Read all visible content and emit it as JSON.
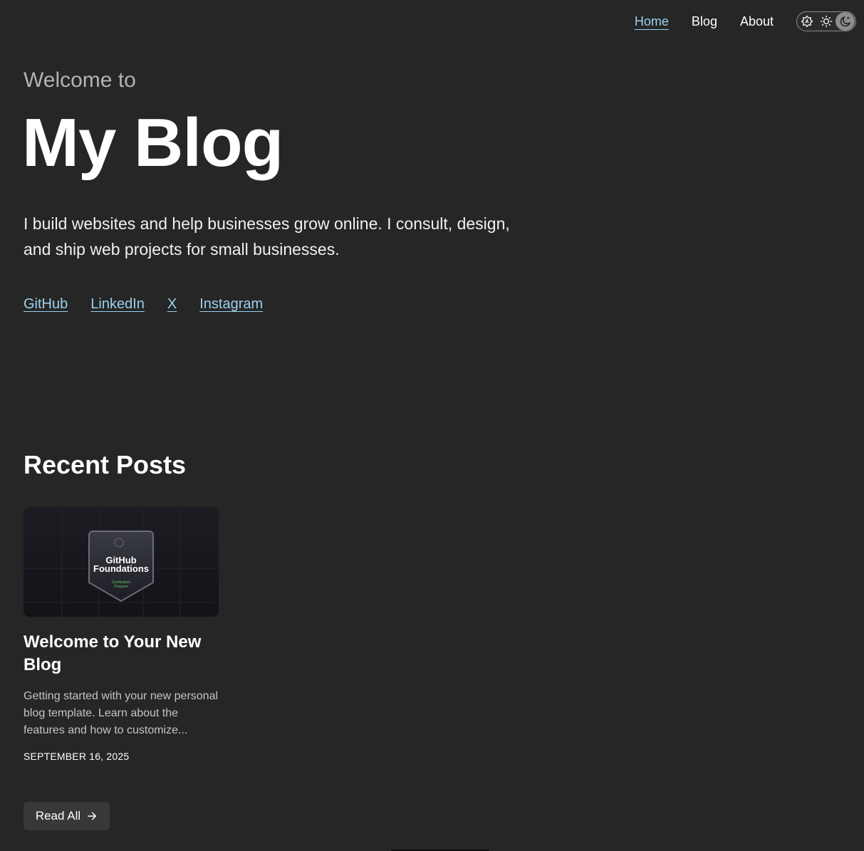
{
  "nav": {
    "links": [
      "Home",
      "Blog",
      "About"
    ],
    "active": "Home",
    "theme_options": [
      "auto-theme-icon",
      "sun-icon",
      "moon-icon"
    ],
    "theme_selected": "moon-icon"
  },
  "hero": {
    "welcome": "Welcome to",
    "title": "My Blog",
    "bio": "I build websites and help businesses grow online. I consult, design, and ship web projects for small businesses.",
    "socials": [
      "GitHub",
      "LinkedIn",
      "X",
      "Instagram"
    ]
  },
  "recent": {
    "heading": "Recent Posts",
    "posts": [
      {
        "image_badge_title_line1": "GitHub",
        "image_badge_title_line2": "Foundations",
        "image_badge_sub_line1": "Certification",
        "image_badge_sub_line2": "Program",
        "title": "Welcome to Your New Blog",
        "excerpt": "Getting started with your new personal blog template. Learn about the features and how to customize...",
        "date": "September 16, 2025"
      }
    ],
    "read_all_label": "Read All"
  },
  "colors": {
    "background": "#262626",
    "accent_link": "#9ad1ee",
    "button_bg": "#383838"
  }
}
